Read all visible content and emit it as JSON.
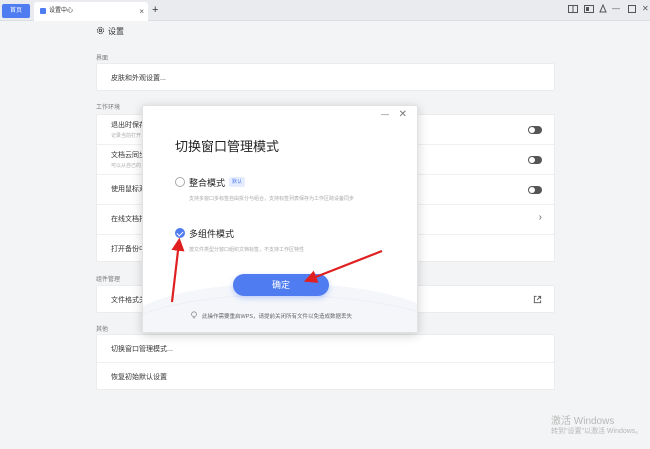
{
  "titlebar": {
    "home_tab": "首页",
    "active_tab": "设置中心",
    "close": "×",
    "new_tab": "+",
    "minimize": "—",
    "close_window": "✕"
  },
  "header": {
    "title": "设置"
  },
  "sections": {
    "interface": {
      "label": "界面",
      "rows": [
        {
          "title": "皮肤和外观设置..."
        }
      ]
    },
    "work_env": {
      "label": "工作环境",
      "rows": [
        {
          "title": "退出时保存",
          "subtitle": "记录当前打开"
        },
        {
          "title": "文档云同步",
          "subtitle": "可以从自己的"
        },
        {
          "title": "使用鼠标双"
        },
        {
          "title": "在线文档打"
        },
        {
          "title": "打开备份中"
        }
      ]
    },
    "components": {
      "label": "组件管理",
      "rows": [
        {
          "title": "文件格式关"
        }
      ]
    },
    "other": {
      "label": "其他",
      "rows": [
        {
          "title": "切换窗口管理模式..."
        },
        {
          "title": "恢复初始默认设置"
        }
      ]
    }
  },
  "dialog": {
    "title": "切换窗口管理模式",
    "minimize": "—",
    "close": "✕",
    "options": [
      {
        "label": "整合模式",
        "badge": "默认",
        "description": "支持多窗口多标签自由拆分与组合，支持标签列表保存为工作区跨设备同步",
        "selected": false
      },
      {
        "label": "多组件模式",
        "description": "按文件类型分窗口组织文档标签，不支持工作区特性",
        "selected": true
      }
    ],
    "confirm_label": "确定",
    "tip": "此操作需要重启WPS，请提前关闭所有文件以免造成数据丢失"
  },
  "watermark": {
    "line1": "激活 Windows",
    "line2": "转到\"设置\"以激活 Windows。"
  },
  "colors": {
    "accent": "#4f7cf0",
    "arrow": "#e02020"
  }
}
